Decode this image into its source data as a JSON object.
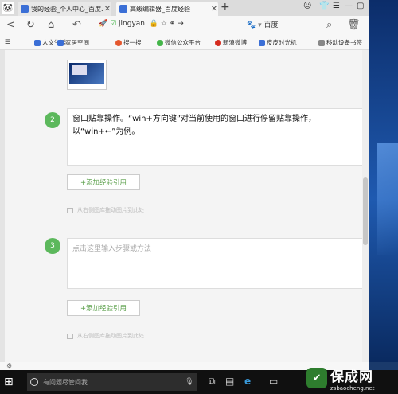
{
  "tabs": [
    {
      "label": "我的经验_个人中心_百度..."
    },
    {
      "label": "高级编辑器_百度经验"
    }
  ],
  "toolbar": {
    "url": "jingyan.",
    "search_engine": "百度"
  },
  "bookmarks": [
    {
      "label": "人文生活",
      "color": "#3b6fd6"
    },
    {
      "label": "家居空间",
      "color": "#3b6fd6"
    },
    {
      "label": "搜一搜",
      "color": "#e4572e"
    },
    {
      "label": "微信公众平台",
      "color": "#44b549"
    },
    {
      "label": "新浪微博",
      "color": "#d52b1e"
    },
    {
      "label": "皮皮时光机",
      "color": "#3b6fd6"
    },
    {
      "label": "移动设备书签",
      "color": "#888888"
    }
  ],
  "steps": [
    {
      "number": "2",
      "text": "窗口贴靠操作。“win+方向键”对当前使用的窗口进行停留贴靠操作，以“win+←”为例。",
      "ref_button": "+添加经验引用",
      "image_hint": "从右侧图库拖动图片到此处"
    },
    {
      "number": "3",
      "placeholder": "点击这里输入步骤或方法",
      "ref_button": "+添加经验引用",
      "image_hint": "从右侧图库拖动图片到此处"
    }
  ],
  "taskbar": {
    "search_placeholder": "有问题尽管问我"
  },
  "watermark": {
    "title": "保成网",
    "url": "zsbaocheng.net"
  },
  "colors": {
    "step_green": "#5cb85c",
    "ref_green": "#5a9f4a"
  }
}
